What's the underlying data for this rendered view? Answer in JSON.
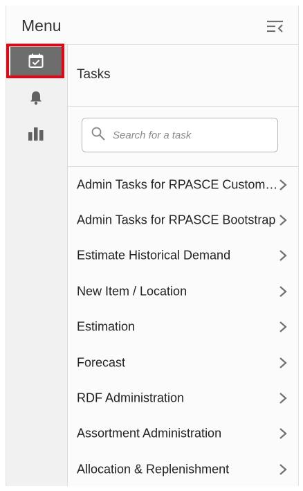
{
  "header": {
    "title": "Menu",
    "collapse_icon": "collapse-menu-icon"
  },
  "rail": {
    "items": [
      {
        "name": "tasks",
        "icon": "calendar-check-icon",
        "active": true
      },
      {
        "name": "notifications",
        "icon": "bell-icon",
        "active": false
      },
      {
        "name": "reports",
        "icon": "bar-chart-icon",
        "active": false
      }
    ],
    "highlight_color": "#e30613"
  },
  "tasks": {
    "title": "Tasks",
    "search": {
      "placeholder": "Search for a task",
      "value": ""
    },
    "items": [
      {
        "label": "Admin Tasks for RPASCE Customization"
      },
      {
        "label": "Admin Tasks for RPASCE Bootstrap"
      },
      {
        "label": "Estimate Historical Demand"
      },
      {
        "label": "New Item / Location"
      },
      {
        "label": "Estimation"
      },
      {
        "label": "Forecast"
      },
      {
        "label": "RDF Administration"
      },
      {
        "label": "Assortment Administration"
      },
      {
        "label": "Allocation & Replenishment"
      }
    ]
  },
  "colors": {
    "active_rail_bg": "#6d6d6d",
    "rail_bg": "#f1f1f1",
    "icon_gray": "#616161"
  }
}
